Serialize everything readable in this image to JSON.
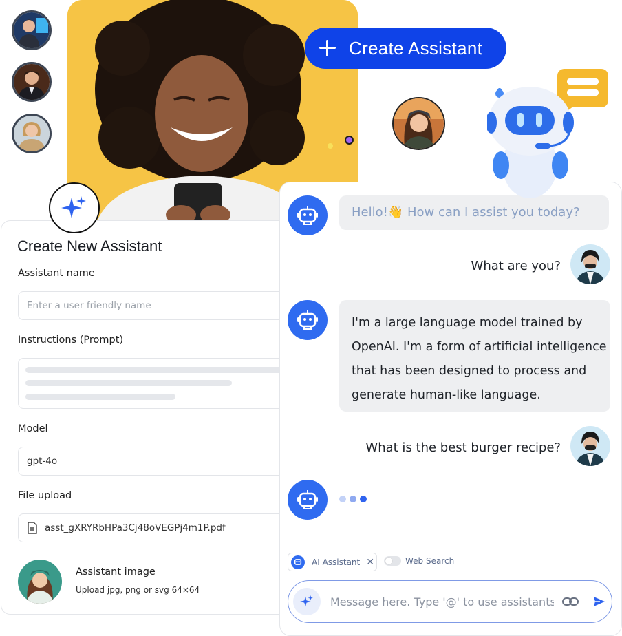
{
  "header": {
    "create_button_label": "Create Assistant"
  },
  "form": {
    "title": "Create New Assistant",
    "assistant_name_label": "Assistant name",
    "assistant_name_placeholder": "Enter a user friendly name",
    "instructions_label": "Instructions (Prompt)",
    "model_label": "Model",
    "model_value": "gpt-4o",
    "file_upload_label": "File upload",
    "file_name": "asst_gXRYRbHPa3Cj48oVEGPj4m1P.pdf",
    "image_label": "Assistant image",
    "image_hint": "Upload jpg, png or svg 64×64"
  },
  "chat": {
    "messages": [
      {
        "role": "assistant",
        "text": "Hello!👋 How can I assist you today?"
      },
      {
        "role": "user",
        "text": "What are you?"
      },
      {
        "role": "assistant",
        "lines": [
          "I'm a large language model trained by",
          "OpenAI. I'm a form of artificial intelligence",
          "that has been designed to process and",
          "generate human-like language."
        ]
      },
      {
        "role": "user",
        "text": "What is the best burger recipe?"
      },
      {
        "role": "assistant",
        "typing": true
      }
    ],
    "chip_label": "AI Assistant",
    "web_search_label": "Web Search",
    "composer_placeholder": "Message here. Type '@' to use assistants"
  },
  "colors": {
    "brand_blue": "#0f43e8",
    "bot_blue": "#2f6bf0",
    "hero_yellow": "#f6c445"
  }
}
